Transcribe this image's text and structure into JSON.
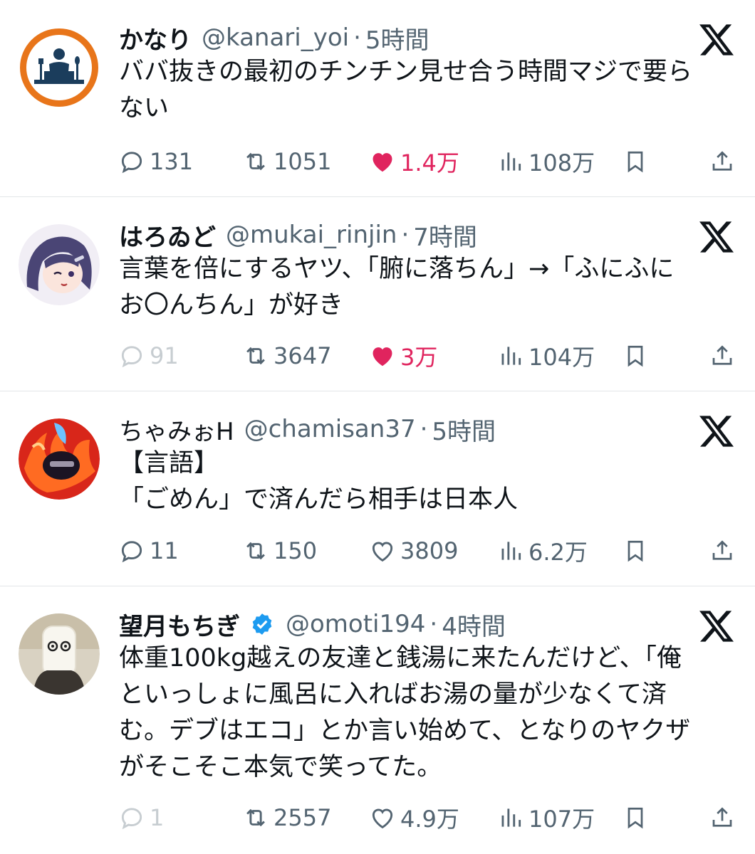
{
  "colors": {
    "like": "#e0245e",
    "muted": "#536471",
    "faded": "#c7cdd1",
    "verified": "#1d9bf0"
  },
  "tweets": [
    {
      "name": "かなり",
      "handle": "@kanari_yoi",
      "time": "5時間",
      "body": [
        "ババ抜きの最初のチンチン見せ合う時間マジで要ら",
        "ない"
      ],
      "replies": "131",
      "retweets": "1051",
      "likes": "1.4万",
      "views": "108万",
      "liked": true,
      "replies_faded": false,
      "verified": false
    },
    {
      "name": "はろゐど",
      "handle": "@mukai_rinjin",
      "time": "7時間",
      "body": [
        "言葉を倍にするヤツ、「腑に落ちん」→「ふにふに",
        "お〇んちん」が好き"
      ],
      "replies": "91",
      "retweets": "3647",
      "likes": "3万",
      "views": "104万",
      "liked": true,
      "replies_faded": true,
      "verified": false
    },
    {
      "name": "ちゃみぉH",
      "handle": "@chamisan37",
      "time": "5時間",
      "body": [
        "【言語】",
        "「ごめん」で済んだら相手は日本人"
      ],
      "replies": "11",
      "retweets": "150",
      "likes": "3809",
      "views": "6.2万",
      "liked": false,
      "replies_faded": false,
      "verified": false
    },
    {
      "name": "望月もちぎ",
      "handle": "@omoti194",
      "time": "4時間",
      "body": [
        "体重100kg越えの友達と銭湯に来たんだけど、「俺",
        "といっしょに風呂に入ればお湯の量が少なくて済",
        "む。デブはエコ」とか言い始めて、となりのヤクザ",
        "がそこそこ本気で笑ってた。"
      ],
      "replies": "1",
      "retweets": "2557",
      "likes": "4.9万",
      "views": "107万",
      "liked": false,
      "replies_faded": true,
      "verified": true
    }
  ]
}
